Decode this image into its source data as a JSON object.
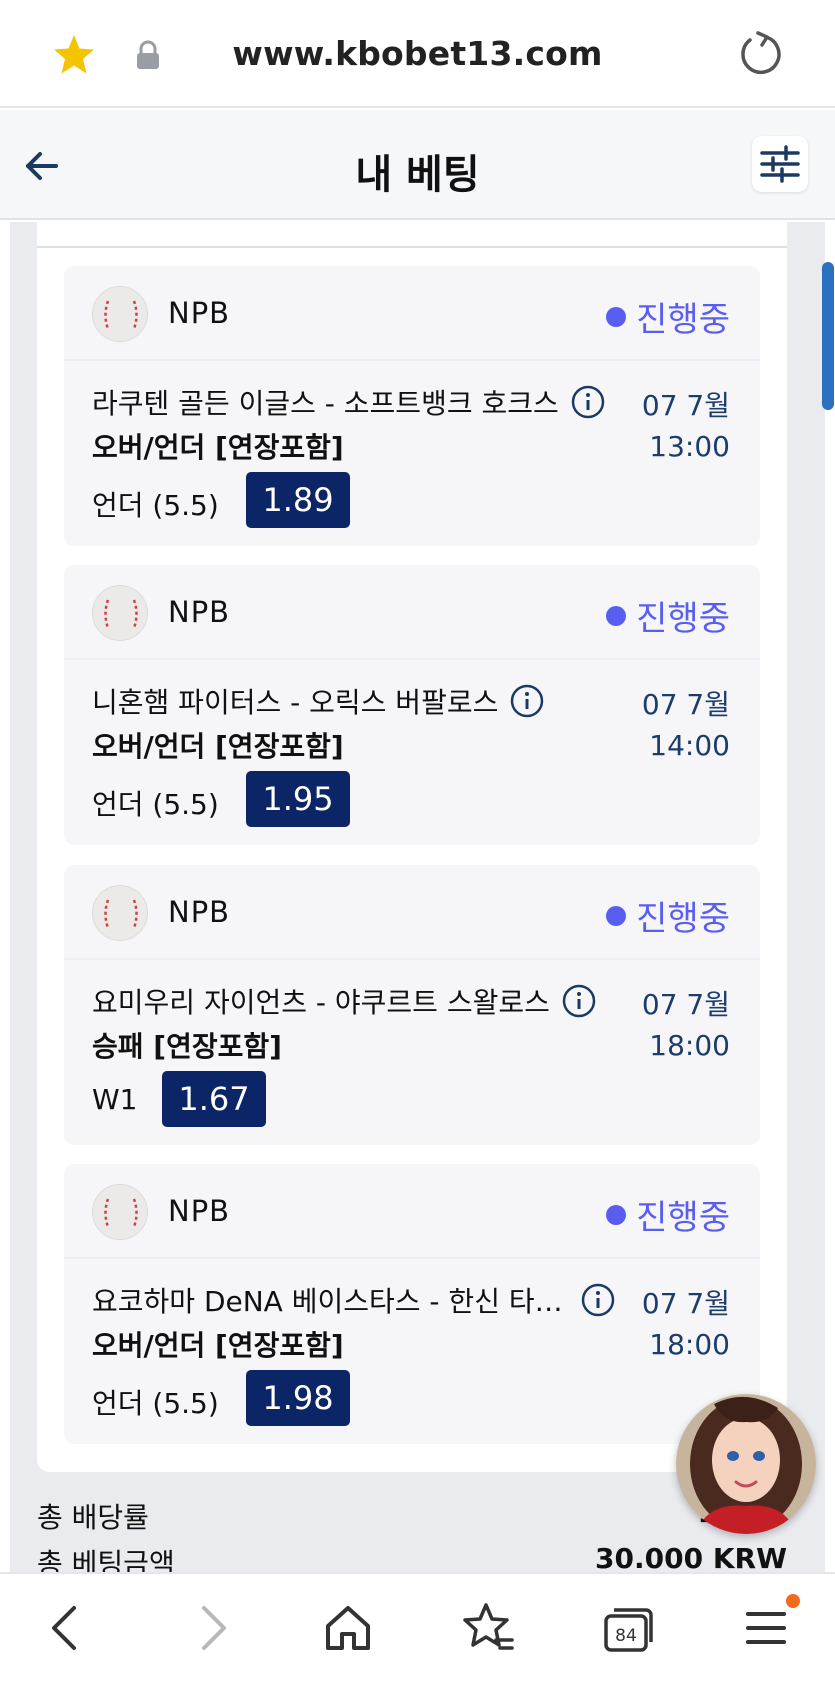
{
  "browser": {
    "url": "www.kbobet13.com",
    "tab_count": "84",
    "accent_star": "#f5c400",
    "menu_badge_color": "#f26a1b"
  },
  "header": {
    "title": "내 베팅"
  },
  "bets": [
    {
      "league": "NPB",
      "status": "진행중",
      "match": "라쿠텐 골든 이글스 - 소프트뱅크 호크스",
      "date": "07 7월",
      "time": "13:00",
      "market": "오버/언더 [연장포함]",
      "selection": "언더 (5.5)",
      "odds": "1.89"
    },
    {
      "league": "NPB",
      "status": "진행중",
      "match": "니혼햄 파이터스 - 오릭스 버팔로스",
      "date": "07 7월",
      "time": "14:00",
      "market": "오버/언더 [연장포함]",
      "selection": "언더 (5.5)",
      "odds": "1.95"
    },
    {
      "league": "NPB",
      "status": "진행중",
      "match": "요미우리 자이언츠 - 야쿠르트 스왈로스",
      "date": "07 7월",
      "time": "18:00",
      "market": "승패 [연장포함]",
      "selection": "W1",
      "odds": "1.67"
    },
    {
      "league": "NPB",
      "status": "진행중",
      "match": "요코하마 DeNA 베이스타스 - 한신 타…",
      "date": "07 7월",
      "time": "18:00",
      "market": "오버/언더 [연장포함]",
      "selection": "언더 (5.5)",
      "odds": "1.98"
    }
  ],
  "summary": {
    "total_odds_label": "총 배당률",
    "total_odds_value": "1",
    "total_stake_label": "총 베팅금액",
    "total_stake_value": "30.000 KRW"
  },
  "colors": {
    "status": "#5a5ef0",
    "odds_bg": "#0b2566",
    "date_text": "#1c3d6c"
  },
  "icons": [
    "star-icon",
    "lock-icon",
    "reload-icon",
    "back-arrow-icon",
    "filter-sliders-icon",
    "baseball-icon",
    "info-icon",
    "chevron-left-icon",
    "chevron-right-icon",
    "home-icon",
    "bookmark-star-icon",
    "tabs-icon",
    "menu-icon"
  ]
}
